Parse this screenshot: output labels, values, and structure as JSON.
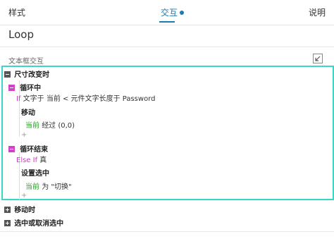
{
  "tabs": {
    "style": "样式",
    "interactions": "交互",
    "notes": "说明"
  },
  "widget": {
    "name": "Loop"
  },
  "interactions_section": {
    "label": "文本框交互"
  },
  "events": [
    {
      "name": "尺寸改变时",
      "expanded": true,
      "cases": [
        {
          "name": "循环中",
          "condition_keyword": "If",
          "condition_text": "文字于 当前 < 元件文字长度于 Password",
          "action": "移动",
          "target": "当前",
          "detail": "经过 (0,0)",
          "add": "+"
        },
        {
          "name": "循环结束",
          "condition_keyword": "Else If",
          "condition_text": "真",
          "action": "设置选中",
          "target": "当前",
          "detail": "为 \"切换\"",
          "add": "+"
        }
      ]
    },
    {
      "name": "移动时",
      "expanded": false
    },
    {
      "name": "选中或取消选中",
      "expanded": false
    }
  ],
  "colors": {
    "accent": "#1a7cb0",
    "selection": "#3cd6c8",
    "case_marker": "#d23fc8",
    "keyword": "#c940c0",
    "target": "#2aa02a"
  }
}
